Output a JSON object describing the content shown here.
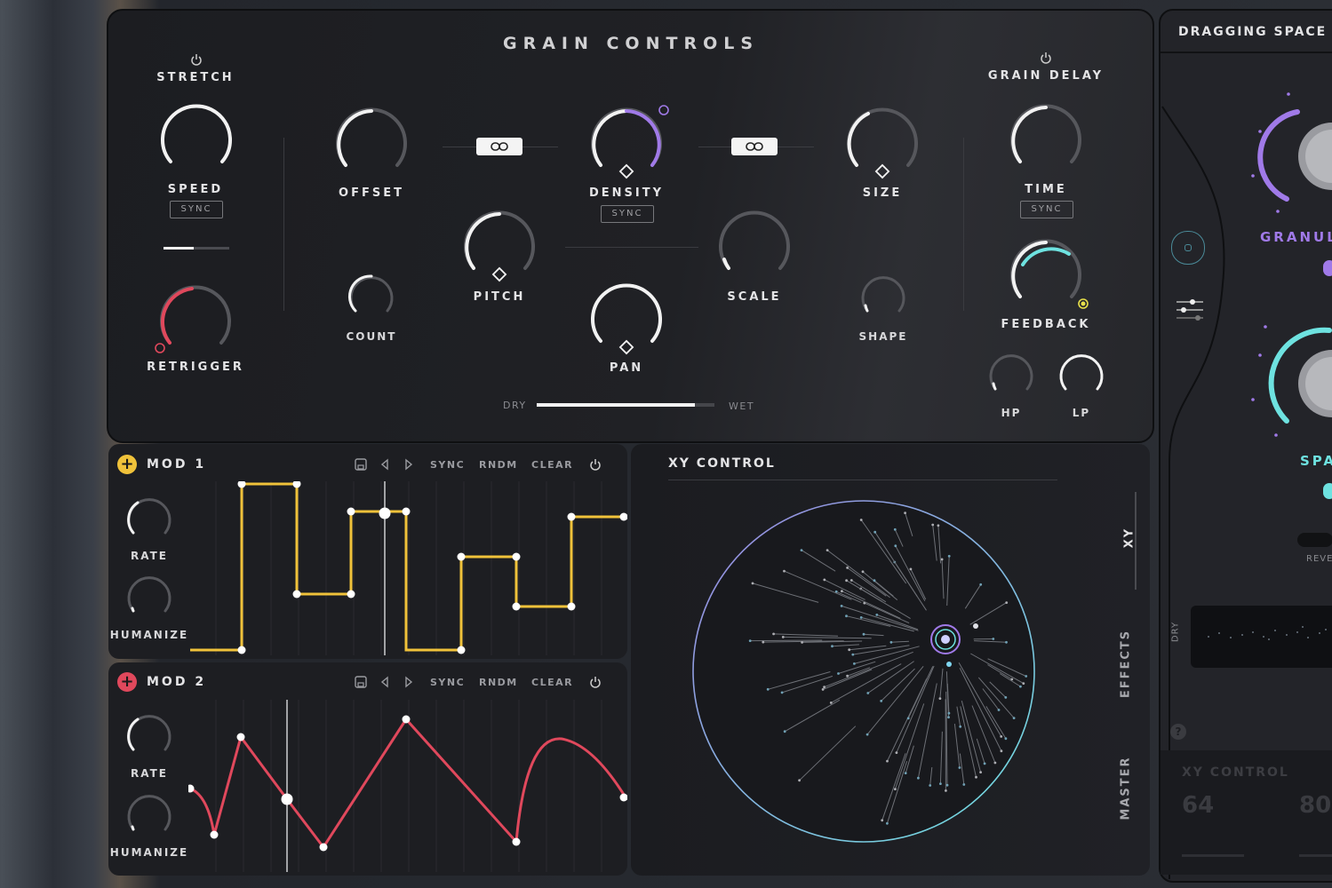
{
  "grain": {
    "title": "GRAIN CONTROLS",
    "stretch": "STRETCH",
    "speed": "SPEED",
    "sync": "SYNC",
    "retrigger": "RETRIGGER",
    "offset": "OFFSET",
    "count": "COUNT",
    "density": "DENSITY",
    "pitch": "PITCH",
    "pan": "PAN",
    "scale": "SCALE",
    "size": "SIZE",
    "shape": "SHAPE",
    "grain_delay": "GRAIN DELAY",
    "time": "TIME",
    "feedback": "FEEDBACK",
    "hp": "HP",
    "lp": "LP",
    "dry": "DRY",
    "wet": "WET"
  },
  "mod1": {
    "title": "MOD 1",
    "rate": "RATE",
    "humanize": "HUMANIZE",
    "sync": "SYNC",
    "rndm": "RNDM",
    "clear": "CLEAR",
    "accent": "#f0c23a"
  },
  "mod2": {
    "title": "MOD 2",
    "rate": "RATE",
    "humanize": "HUMANIZE",
    "sync": "SYNC",
    "rndm": "RNDM",
    "clear": "CLEAR",
    "accent": "#e0485c"
  },
  "xy": {
    "title": "XY CONTROL",
    "tabs": [
      "XY",
      "EFFECTS",
      "MASTER"
    ]
  },
  "right": {
    "title": "DRAGGING SPACE",
    "granul": "GRANUL",
    "spa": "SPA",
    "reve": "REVE",
    "dry": "DRY",
    "xy_title": "XY CONTROL",
    "val1": "64",
    "val2": "80",
    "help": "?"
  },
  "colors": {
    "purple": "#a07ae8",
    "teal": "#6ee2e0",
    "red": "#e0485c",
    "yellow": "#f0c23a"
  }
}
